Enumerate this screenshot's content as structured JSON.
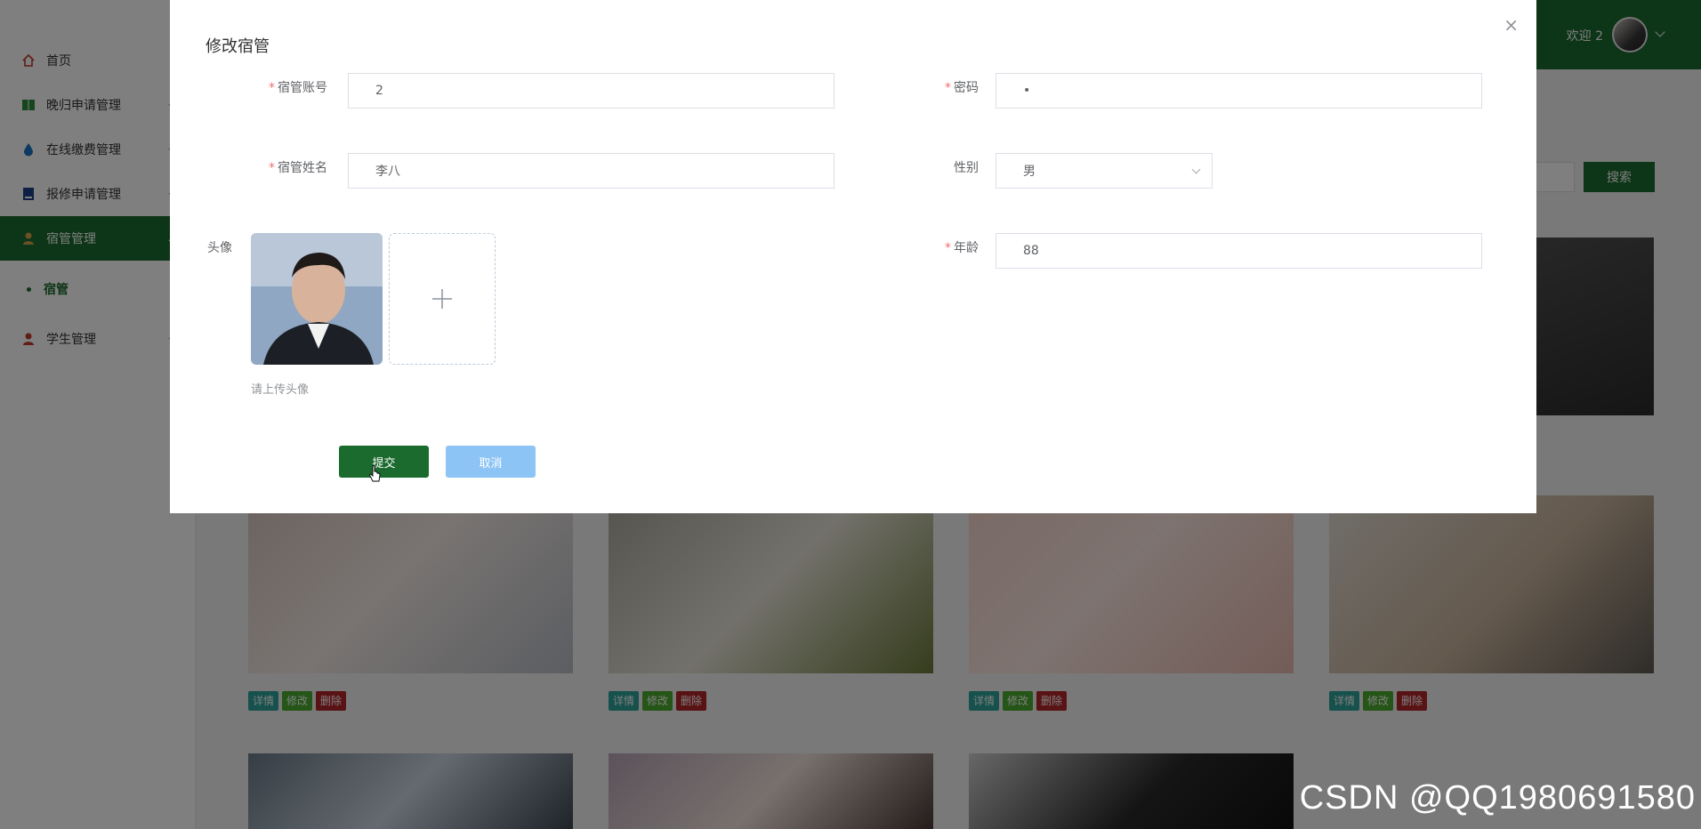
{
  "header": {
    "welcome": "欢迎 2"
  },
  "sidebar": {
    "items": [
      {
        "label": "首页",
        "icon": "home-icon"
      },
      {
        "label": "晚归申请管理",
        "icon": "book-icon"
      },
      {
        "label": "在线缴费管理",
        "icon": "drop-icon"
      },
      {
        "label": "报修申请管理",
        "icon": "book-blue-icon"
      },
      {
        "label": "宿管管理",
        "icon": "user-icon"
      },
      {
        "label": "学生管理",
        "icon": "user-icon"
      }
    ],
    "sub_item": "宿管"
  },
  "search": {
    "button": "搜索"
  },
  "cards": {
    "detail": "详情",
    "edit": "修改",
    "delete": "删除"
  },
  "dialog": {
    "title": "修改宿管",
    "close": "×",
    "fields": {
      "account_label": "宿管账号",
      "account_value": "2",
      "password_label": "密码",
      "password_value": "•",
      "name_label": "宿管姓名",
      "name_value": "李八",
      "gender_label": "性别",
      "gender_value": "男",
      "avatar_label": "头像",
      "avatar_tip": "请上传头像",
      "age_label": "年龄",
      "age_value": "88"
    },
    "submit": "提交",
    "cancel": "取消"
  },
  "watermark": "CSDN @QQ1980691580",
  "colors": {
    "primary": "#1b6b2e",
    "cancel": "#8cc4f5",
    "danger": "#b3262a"
  }
}
